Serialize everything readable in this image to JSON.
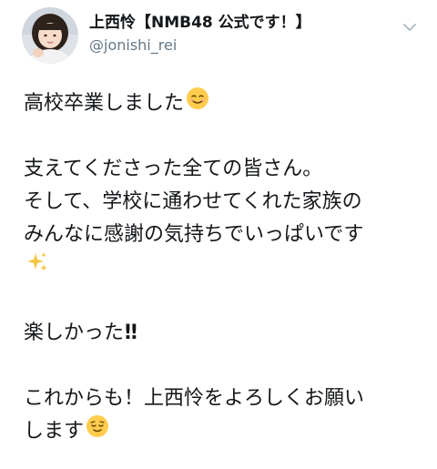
{
  "user": {
    "display_name": "上西怜【NMB48 公式です！】",
    "screen_name": "@jonishi_rei",
    "avatar_icon": "profile-photo"
  },
  "menu": {
    "caret_icon": "chevron-down-icon"
  },
  "tweet": {
    "line1": "高校卒業しました",
    "line2": "支えてくださった全ての皆さん。",
    "line3": "そして、学校に通わせてくれた家族の",
    "line4": "みんなに感謝の気持ちでいっぱいです",
    "line5_emoji": "sparkles",
    "line6": "楽しかった",
    "line6_bang": "‼",
    "line7": "これからも！上西怜をよろしくお願い",
    "line8": "します"
  },
  "colors": {
    "text": "#14171a",
    "secondary": "#657786",
    "emoji_face": "#ffcc4d",
    "sparkle": "#f4c542"
  }
}
